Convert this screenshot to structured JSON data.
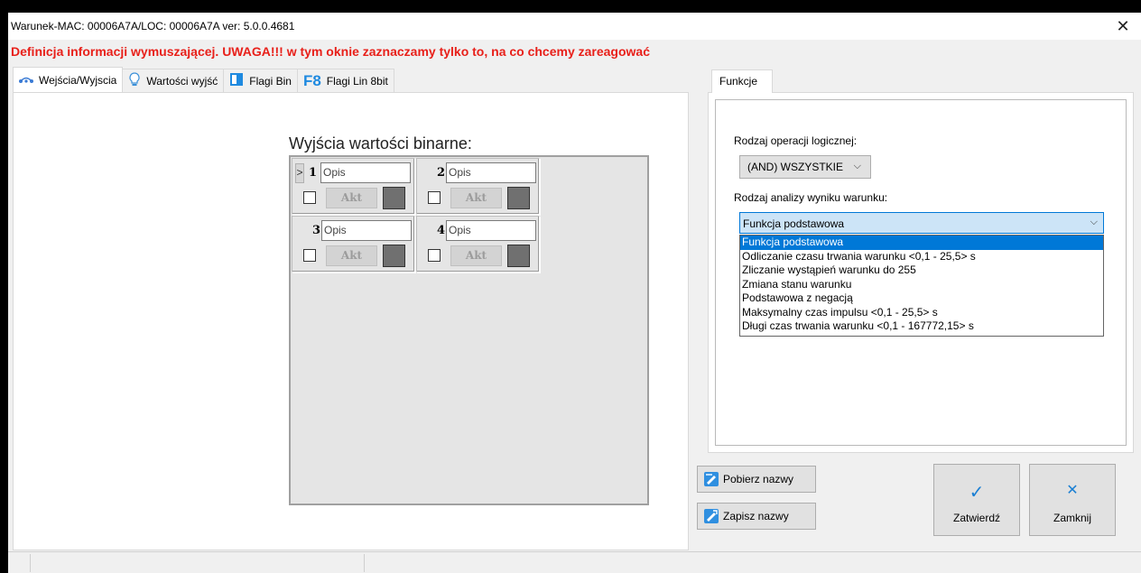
{
  "window": {
    "title": "Warunek-MAC: 00006A7A/LOC: 00006A7A ver: 5.0.0.4681",
    "close": "✕"
  },
  "warning": "Definicja informacji wymuszającej. UWAGA!!! w tym oknie zaznaczamy tylko to, na co chcemy zareagować",
  "tabs_left": [
    {
      "label": "Wejścia/Wyjscia",
      "icon": "io-icon",
      "active": true
    },
    {
      "label": "Wartości wyjść",
      "icon": "bulb-icon",
      "active": false
    },
    {
      "label": "Flagi Bin",
      "icon": "flag-bin-icon",
      "active": false
    },
    {
      "label": "Flagi Lin 8bit",
      "icon": "f8-icon",
      "active": false
    }
  ],
  "outputs": {
    "title": "Wyjścia wartości binarne:",
    "cells": [
      {
        "num": "1",
        "opis": "Opis",
        "akt": "Akt",
        "chevron": ">"
      },
      {
        "num": "2",
        "opis": "Opis",
        "akt": "Akt"
      },
      {
        "num": "3",
        "opis": "Opis",
        "akt": "Akt"
      },
      {
        "num": "4",
        "opis": "Opis",
        "akt": "Akt"
      }
    ]
  },
  "functions": {
    "tab_label": "Funkcje",
    "logic_label": "Rodzaj operacji logicznej:",
    "logic_value": "(AND) WSZYSTKIE",
    "analysis_label": "Rodzaj analizy wyniku warunku:",
    "analysis_value": "Funkcja podstawowa",
    "analysis_options": [
      "Funkcja podstawowa",
      "Odliczanie czasu trwania warunku <0,1 - 25,5> s",
      "Zliczanie wystąpień warunku do 255",
      "Zmiana stanu warunku",
      "Podstawowa z negacją",
      "Maksymalny czas impulsu <0,1 - 25,5> s",
      "Długi czas trwania warunku <0,1 - 167772,15> s"
    ],
    "selected_index": 0
  },
  "buttons": {
    "fetch_names": "Pobierz nazwy",
    "save_names": "Zapisz nazwy",
    "confirm": "Zatwierdź",
    "close": "Zamknij",
    "confirm_symbol": "✓",
    "close_symbol": "✕"
  },
  "colors": {
    "warning": "#e8201a",
    "accent": "#0078d7",
    "confirm_icon": "#1a7fd3"
  }
}
